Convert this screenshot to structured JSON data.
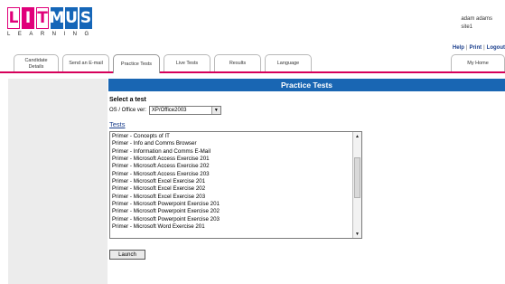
{
  "logo": {
    "letters": [
      "L",
      "I",
      "T",
      "M",
      "U",
      "S"
    ],
    "letter_bg": [
      "#ffffff",
      "#e0007a",
      "#ffffff",
      "#1566b8",
      "#1566b8",
      "#1566b8"
    ],
    "letter_fg": [
      "#e0007a",
      "#ffffff",
      "#e0007a",
      "#ffffff",
      "#ffffff",
      "#ffffff"
    ],
    "tagline": "LEARNING"
  },
  "user": {
    "name": "adam adams",
    "site": "site1"
  },
  "toplinks": {
    "help": "Help",
    "print": "Print",
    "logout": "Logout"
  },
  "tabs": [
    {
      "line1": "Candidate",
      "line2": "Details"
    },
    {
      "line1": "Send an E-mail",
      "line2": ""
    },
    {
      "line1": "Practice Tests",
      "line2": ""
    },
    {
      "line1": "Live Tests",
      "line2": ""
    },
    {
      "line1": "Results",
      "line2": ""
    },
    {
      "line1": "Language",
      "line2": ""
    },
    {
      "line1": "My Home",
      "line2": ""
    }
  ],
  "active_tab": "Practice Tests",
  "accent_color": "#d6005a",
  "header_color": "#1966b3",
  "main": {
    "header": "Practice Tests",
    "select_title": "Select a test",
    "os_label": "OS / Office ver:",
    "os_value": "XP/Office2003",
    "tests_link": "Tests",
    "tests": [
      "Primer - Concepts of IT",
      "Primer - Info and Comms Browser",
      "Primer - Information and Comms E-Mail",
      "Primer - Microsoft Access Exercise 201",
      "Primer - Microsoft Access Exercise 202",
      "Primer - Microsoft Access Exercise 203",
      "Primer - Microsoft Excel Exercise 201",
      "Primer - Microsoft Excel Exercise 202",
      "Primer - Microsoft Excel Exercise 203",
      "Primer - Microsoft Powerpoint Exercise 201",
      "Primer - Microsoft Powerpoint Exercise 202",
      "Primer - Microsoft Powerpoint Exercise 203",
      "Primer - Microsoft Word Exercise 201"
    ],
    "launch_label": "Launch"
  }
}
